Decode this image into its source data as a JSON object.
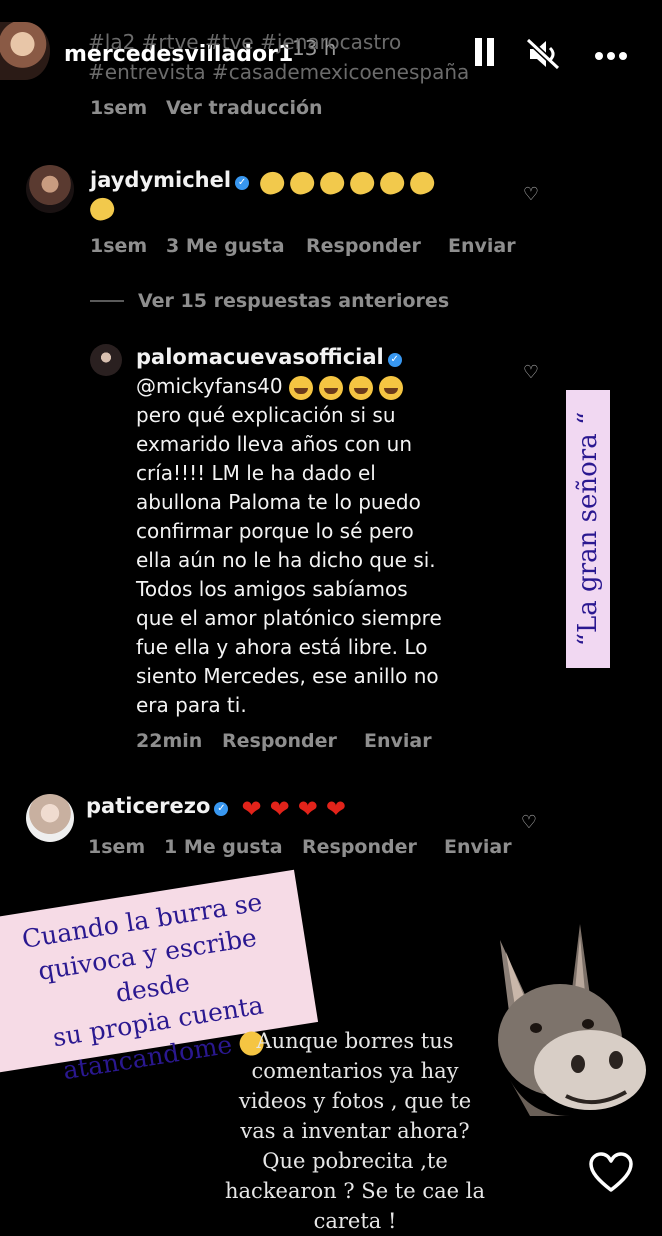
{
  "header": {
    "username": "mercedesvillador1",
    "time": "13 h",
    "hashtags_line1": "#la2 #rtve #tve #jenarocastro",
    "hashtags_line2": "#entrevista #casademexicoenespaña",
    "age": "1sem",
    "translate": "Ver traducción",
    "pause_icon": "pause-icon",
    "mute_icon": "mute-icon",
    "more_icon": "more-icon"
  },
  "comments": [
    {
      "user": "jaydymichel",
      "emoji": "clap",
      "emoji_count": 7,
      "age": "1sem",
      "likes": "3 Me gusta",
      "reply": "Responder",
      "send": "Enviar"
    },
    {
      "user": "palomacuevasofficial",
      "mention": "@mickyfans40",
      "emoji": "laugh",
      "emoji_count": 4,
      "lines": [
        "pero qué explicación si su",
        "exmarido lleva años con un",
        "cría!!!! LM le ha dado el",
        "abullona Paloma te lo puedo",
        "confirmar porque lo sé pero",
        "ella aún no le ha dicho que si.",
        "Todos los amigos sabíamos",
        "que el amor platónico siempre",
        "fue ella y ahora está libre. Lo",
        "siento Mercedes, ese anillo no",
        "era para ti."
      ],
      "age": "22min",
      "reply": "Responder",
      "send": "Enviar"
    },
    {
      "user": "paticerezo",
      "emoji": "red-heart",
      "emoji_count": 4,
      "age": "1sem",
      "likes": "1 Me gusta",
      "reply": "Responder",
      "send": "Enviar"
    }
  ],
  "view_replies": "Ver 15 respuestas anteriores",
  "stickers": {
    "gran_senora": "“La gran señora “",
    "burra_lines": [
      "Cuando la burra se",
      "quivoca y escribe desde",
      "su propia cuenta",
      "atancandome"
    ],
    "borres_lines": [
      "Aunque borres tus",
      "comentarios ya hay",
      "videos y fotos , que te",
      "vas a inventar ahora?",
      "Que pobrecita ,te",
      "hackearon ? Se te cae la",
      "careta !"
    ]
  },
  "colors": {
    "background": "#000000",
    "sticker_pink": "#f6dbe6",
    "sticker_lilac": "#f1d8f2",
    "sticker_text": "#2a1890",
    "verified": "#3897f0",
    "heart_red": "#e2231a"
  }
}
